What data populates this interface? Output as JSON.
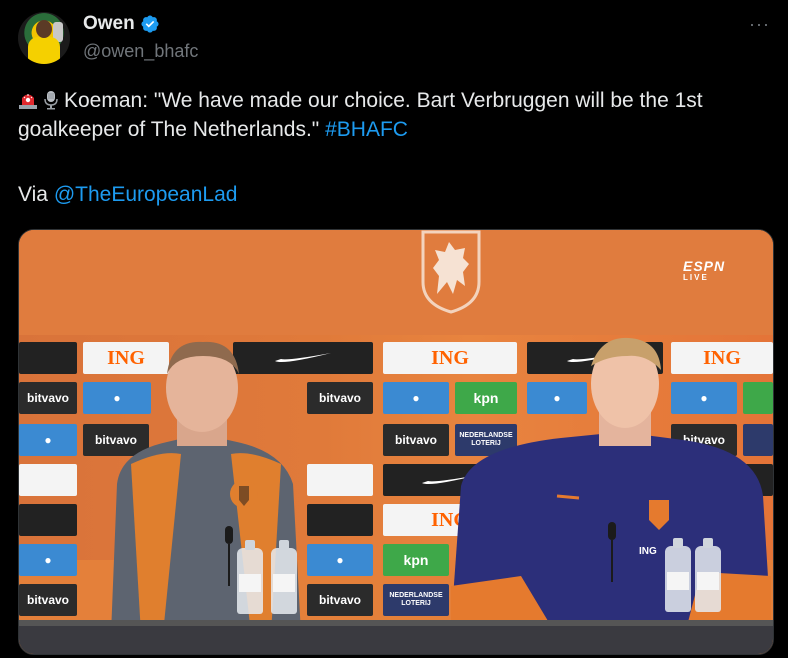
{
  "author": {
    "display_name": "Owen",
    "handle": "@owen_bhafc",
    "verified": true
  },
  "menu": {
    "more_label": "···"
  },
  "tweet": {
    "emojis": [
      "siren-icon",
      "microphone-icon"
    ],
    "text": "Koeman: \"We have made our choice. Bart Verbruggen will be the 1st goalkeeper of The Netherlands.\"",
    "hashtag": "#BHAFC",
    "via_label": "Via",
    "via_mention": "@TheEuropeanLad"
  },
  "media": {
    "broadcaster": "ESPN",
    "broadcaster_sub": "LIVE",
    "sponsors": [
      "ING",
      "bitvavo",
      "kpn",
      "NEDERLANDSE LOTERIJ"
    ],
    "mic_label": "ING"
  },
  "colors": {
    "background": "#000000",
    "text": "#e7e9ea",
    "muted": "#71767b",
    "link": "#1d9bf0",
    "verified": "#1d9bf0",
    "knvb_orange": "#e07c3e"
  }
}
